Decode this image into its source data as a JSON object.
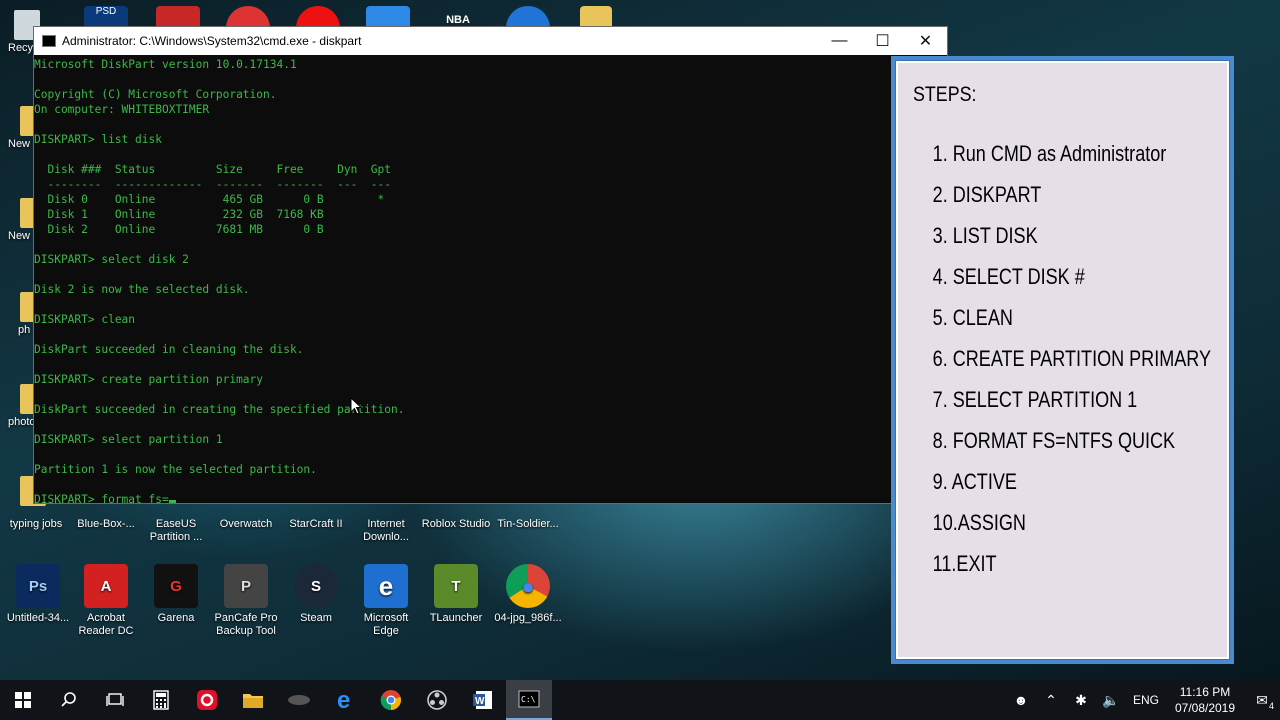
{
  "desktop": {
    "top_icon_label": "PSD",
    "top_icon_text_nba": "NBA",
    "left_labels": [
      "Recy",
      "New",
      "New",
      "ph",
      "photo"
    ],
    "row1": [
      {
        "label": "typing jobs"
      },
      {
        "label": "Blue-Box-..."
      },
      {
        "label": "EaseUS Partition ..."
      },
      {
        "label": "Overwatch"
      },
      {
        "label": "StarCraft II"
      },
      {
        "label": "Internet Downlo..."
      },
      {
        "label": "Roblox Studio"
      },
      {
        "label": "Tin-Soldier..."
      }
    ],
    "row2": [
      {
        "label": "Untitled-34...",
        "glyph": "Ps",
        "badge": "PSD",
        "color": "#0b2a5e"
      },
      {
        "label": "Acrobat Reader DC",
        "glyph": "A",
        "color": "#d32020"
      },
      {
        "label": "Garena",
        "glyph": "G",
        "color": "#111111"
      },
      {
        "label": "PanCafe Pro Backup Tool",
        "glyph": "P",
        "color": "#444444"
      },
      {
        "label": "Steam",
        "glyph": "S",
        "color": "#1b2838"
      },
      {
        "label": "Microsoft Edge",
        "glyph": "e",
        "color": "#1f6fd1"
      },
      {
        "label": "TLauncher",
        "glyph": "T",
        "color": "#5a8a2a"
      },
      {
        "label": "04-jpg_986f...",
        "glyph": "●",
        "color": "#f4f4f4"
      }
    ]
  },
  "cmd": {
    "title": "Administrator: C:\\Windows\\System32\\cmd.exe - diskpart",
    "minimize_glyph": "—",
    "maximize_glyph": "☐",
    "close_glyph": "✕",
    "lines": [
      "Microsoft DiskPart version 10.0.17134.1",
      "",
      "Copyright (C) Microsoft Corporation.",
      "On computer: WHITEBOXTIMER",
      "",
      "DISKPART> list disk",
      "",
      "  Disk ###  Status         Size     Free     Dyn  Gpt",
      "  --------  -------------  -------  -------  ---  ---",
      "  Disk 0    Online          465 GB      0 B        *",
      "  Disk 1    Online          232 GB  7168 KB",
      "  Disk 2    Online         7681 MB      0 B",
      "",
      "DISKPART> select disk 2",
      "",
      "Disk 2 is now the selected disk.",
      "",
      "DISKPART> clean",
      "",
      "DiskPart succeeded in cleaning the disk.",
      "",
      "DISKPART> create partition primary",
      "",
      "DiskPart succeeded in creating the specified partition.",
      "",
      "DISKPART> select partition 1",
      "",
      "Partition 1 is now the selected partition.",
      ""
    ],
    "prompt_line": "DISKPART> format fs="
  },
  "steps": {
    "title": "STEPS:",
    "items": [
      "1.  Run CMD as Administrator",
      "2.  DISKPART",
      "3.  LIST DISK",
      "4.  SELECT DISK #",
      "5.  CLEAN",
      "6.  CREATE PARTITION PRIMARY",
      "7.  SELECT PARTITION 1",
      "8.  FORMAT FS=NTFS QUICK",
      "9.  ACTIVE",
      "10.ASSIGN",
      "11.EXIT"
    ]
  },
  "taskbar": {
    "language": "ENG",
    "time": "11:16 PM",
    "date": "07/08/2019",
    "notification_count": "4"
  }
}
